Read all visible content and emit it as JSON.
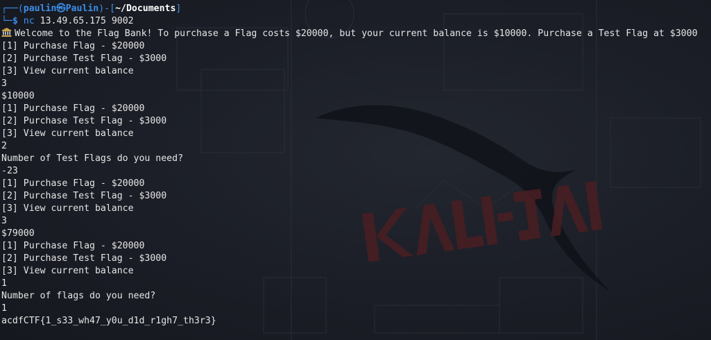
{
  "prompt": {
    "line1_prefix": "┌──(",
    "user": "paulin",
    "at_symbol": "㉿",
    "host": "Paulin",
    "mid": ")-[",
    "cwd": "~/Documents",
    "line1_suffix": "]",
    "line2_prefix": "└─",
    "dollar": "$",
    "command": "nc",
    "args": "13.49.65.175 9002"
  },
  "output": [
    "Welcome to the Flag Bank! To purchase a Flag costs $20000, but your current balance is $10000. Purchase a Test Flag at $3000",
    "[1] Purchase Flag - $20000",
    "[2] Purchase Test Flag - $3000",
    "[3] View current balance",
    "3",
    "$10000",
    "[1] Purchase Flag - $20000",
    "[2] Purchase Test Flag - $3000",
    "[3] View current balance",
    "2",
    "Number of Test Flags do you need?",
    "-23",
    "[1] Purchase Flag - $20000",
    "[2] Purchase Test Flag - $3000",
    "[3] View current balance",
    "3",
    "$79000",
    "[1] Purchase Flag - $20000",
    "[2] Purchase Test Flag - $3000",
    "[3] View current balance",
    "1",
    "Number of flags do you need?",
    "1",
    "acdfCTF{1_s33_wh47_y0u_d1d_r1gh7_th3r3}"
  ],
  "icons": {
    "bank": "bank-icon"
  },
  "colors": {
    "background": "#1c1f28",
    "text": "#e6e6e6",
    "prompt": "#3b8eea",
    "wallpaper_logo": "#4a1e22"
  }
}
